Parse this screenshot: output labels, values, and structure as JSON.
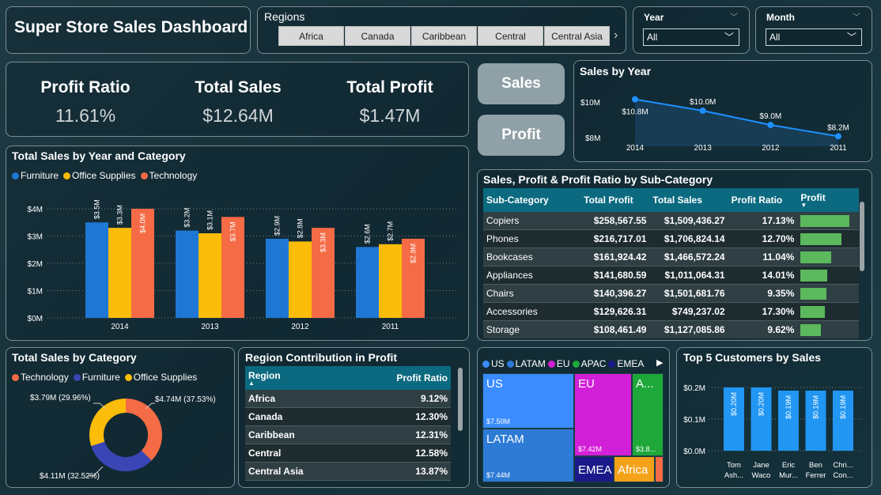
{
  "header": {
    "title": "Super Store Sales Dashboard",
    "regions_label": "Regions",
    "regions": [
      "Africa",
      "Canada",
      "Caribbean",
      "Central",
      "Central Asia"
    ],
    "year_label": "Year",
    "year_value": "All",
    "month_label": "Month",
    "month_value": "All"
  },
  "kpis": [
    {
      "label": "Profit Ratio",
      "value": "11.61%"
    },
    {
      "label": "Total Sales",
      "value": "$12.64M"
    },
    {
      "label": "Total Profit",
      "value": "$1.47M"
    }
  ],
  "toggles": {
    "sales": "Sales",
    "profit": "Profit"
  },
  "sales_by_year": {
    "title": "Sales by Year",
    "y_ticks": [
      "$10M",
      "$8M"
    ],
    "x_labels": [
      "2014",
      "2013",
      "2012",
      "2011"
    ],
    "data_labels": [
      "$10.8M",
      "$10.0M",
      "$9.0M",
      "$8.2M"
    ]
  },
  "category_chart": {
    "title": "Total Sales by Year and Category",
    "y_ticks": [
      "$4M",
      "$3M",
      "$2M",
      "$1M",
      "$0M"
    ],
    "legend": [
      {
        "name": "Furniture",
        "color": "#1f77d4"
      },
      {
        "name": "Office Supplies",
        "color": "#fcbc0a"
      },
      {
        "name": "Technology",
        "color": "#f46b45"
      }
    ]
  },
  "subcat": {
    "title": "Sales, Profit & Profit Ratio by Sub-Category",
    "headers": [
      "Sub-Category",
      "Total Profit",
      "Total Sales",
      "Profit Ratio",
      "Profit"
    ],
    "rows": [
      {
        "name": "Copiers",
        "profit": "$258,567.55",
        "sales": "$1,509,436.27",
        "ratio": "17.13%",
        "bar": 1.0
      },
      {
        "name": "Phones",
        "profit": "$216,717.01",
        "sales": "$1,706,824.14",
        "ratio": "12.70%",
        "bar": 0.84
      },
      {
        "name": "Bookcases",
        "profit": "$161,924.42",
        "sales": "$1,466,572.24",
        "ratio": "11.04%",
        "bar": 0.63
      },
      {
        "name": "Appliances",
        "profit": "$141,680.59",
        "sales": "$1,011,064.31",
        "ratio": "14.01%",
        "bar": 0.55
      },
      {
        "name": "Chairs",
        "profit": "$140,396.27",
        "sales": "$1,501,681.76",
        "ratio": "9.35%",
        "bar": 0.54
      },
      {
        "name": "Accessories",
        "profit": "$129,626.31",
        "sales": "$749,237.02",
        "ratio": "17.30%",
        "bar": 0.5
      },
      {
        "name": "Storage",
        "profit": "$108,461.49",
        "sales": "$1,127,085.86",
        "ratio": "9.62%",
        "bar": 0.42
      }
    ]
  },
  "donut": {
    "title": "Total Sales by Category",
    "legend": [
      {
        "name": "Technology",
        "color": "#f46b45"
      },
      {
        "name": "Furniture",
        "color": "#3a46b5"
      },
      {
        "name": "Office Supplies",
        "color": "#fcbc0a"
      }
    ],
    "labels": {
      "technology": "$4.74M (37.53%)",
      "furniture": "$4.11M (32.52%)",
      "office": "$3.79M (29.96%)"
    }
  },
  "region_profit": {
    "title": "Region Contribution in Profit",
    "headers": [
      "Region",
      "Profit Ratio"
    ],
    "rows": [
      {
        "name": "Africa",
        "ratio": "9.12%"
      },
      {
        "name": "Canada",
        "ratio": "12.30%"
      },
      {
        "name": "Caribbean",
        "ratio": "12.31%"
      },
      {
        "name": "Central",
        "ratio": "12.58%"
      },
      {
        "name": "Central Asia",
        "ratio": "13.87%"
      }
    ]
  },
  "treemap": {
    "legend": [
      {
        "name": "US",
        "color": "#3b8cff"
      },
      {
        "name": "LATAM",
        "color": "#2e7bd6"
      },
      {
        "name": "EU",
        "color": "#d21fd8"
      },
      {
        "name": "APAC",
        "color": "#1ea83a"
      },
      {
        "name": "EMEA",
        "color": "#1a1a8a"
      }
    ],
    "cells": [
      {
        "label": "US",
        "value": "$7.50M"
      },
      {
        "label": "LATAM",
        "value": "$7.44M"
      },
      {
        "label": "EU",
        "value": "$7.42M"
      },
      {
        "label": "A...",
        "value": "$3.8..."
      },
      {
        "label": "EMEA",
        "value": ""
      },
      {
        "label": "Africa",
        "value": ""
      }
    ]
  },
  "top_customers": {
    "title": "Top 5 Customers by Sales",
    "y_ticks": [
      "$0.2M",
      "$0.1M",
      "$0.0M"
    ],
    "bars": [
      {
        "l1": "Tom",
        "l2": "Ash...",
        "val": "$0.20M"
      },
      {
        "l1": "Jane",
        "l2": "Waco",
        "val": "$0.20M"
      },
      {
        "l1": "Eric",
        "l2": "Mur...",
        "val": "$0.19M"
      },
      {
        "l1": "Ben",
        "l2": "Ferrer",
        "val": "$0.19M"
      },
      {
        "l1": "Chri...",
        "l2": "Con...",
        "val": "$0.19M"
      }
    ]
  },
  "chart_data": [
    {
      "type": "line",
      "title": "Sales by Year",
      "x": [
        "2014",
        "2013",
        "2012",
        "2011"
      ],
      "series": [
        {
          "values": [
            10.8,
            10.0,
            9.0,
            8.2
          ]
        }
      ],
      "ylim": [
        7.5,
        11.5
      ],
      "grid": false
    },
    {
      "type": "bar",
      "title": "Total Sales by Year and Category",
      "categories": [
        "2014",
        "2013",
        "2012",
        "2011"
      ],
      "series": [
        {
          "name": "Furniture",
          "values": [
            3.5,
            3.2,
            2.9,
            2.6
          ],
          "labels": [
            "$3.5M",
            "$3.2M",
            "$2.9M",
            "$2.6M"
          ]
        },
        {
          "name": "Office Supplies",
          "values": [
            3.3,
            3.1,
            2.8,
            2.7
          ],
          "labels": [
            "$3.3M",
            "$3.1M",
            "$2.8M",
            "$2.7M"
          ]
        },
        {
          "name": "Technology",
          "values": [
            4.0,
            3.7,
            3.3,
            2.9
          ],
          "labels": [
            "$4.0M",
            "$3.7M",
            "$3.3M",
            "$2.9M"
          ]
        }
      ],
      "ylim": [
        0,
        4.2
      ],
      "legend": "top-left"
    },
    {
      "type": "pie",
      "title": "Total Sales by Category",
      "categories": [
        "Technology",
        "Furniture",
        "Office Supplies"
      ],
      "values": [
        4.74,
        4.11,
        3.79
      ]
    },
    {
      "type": "bar",
      "title": "Top 5 Customers by Sales",
      "categories": [
        "Tom Ash...",
        "Jane Waco",
        "Eric Mur...",
        "Ben Ferrer",
        "Chri... Con..."
      ],
      "values": [
        0.2,
        0.2,
        0.19,
        0.19,
        0.19
      ],
      "ylim": [
        0,
        0.2
      ]
    }
  ]
}
